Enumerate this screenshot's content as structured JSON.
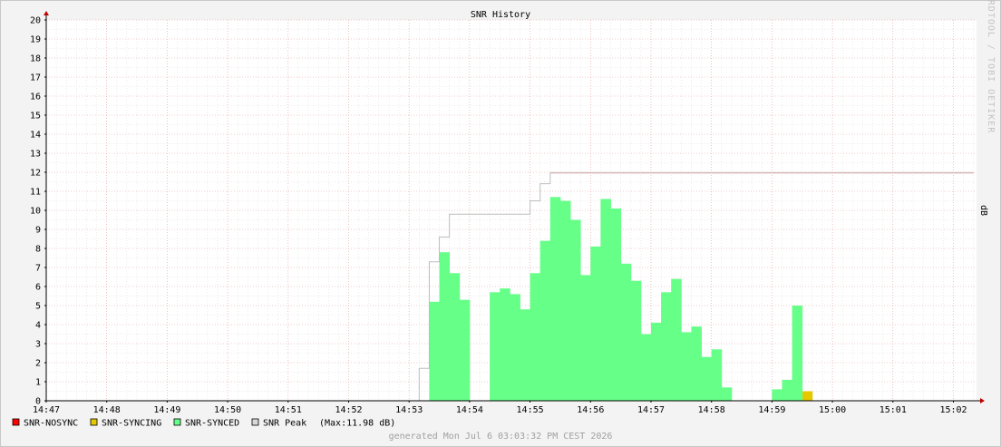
{
  "chart_data": {
    "type": "area",
    "title": "SNR History",
    "ylabel": "dB",
    "ylim": [
      0,
      20
    ],
    "yticks": [
      "0",
      "1",
      "2",
      "3",
      "4",
      "5",
      "6",
      "7",
      "8",
      "9",
      "10",
      "11",
      "12",
      "13",
      "14",
      "15",
      "16",
      "17",
      "18",
      "19",
      "20"
    ],
    "xlim": [
      "14:47:00",
      "14:59:30"
    ],
    "xticks": [
      "14:47",
      "14:48",
      "14:49",
      "14:50",
      "14:51",
      "14:52",
      "14:53",
      "14:54",
      "14:55",
      "14:56",
      "14:57",
      "14:58",
      "14:59",
      "15:00",
      "15:01",
      "15:02"
    ],
    "grid": true,
    "bucket_seconds": 10,
    "series": [
      {
        "name": "SNR-NOSYNC",
        "color": "#ff0000",
        "values": []
      },
      {
        "name": "SNR-SYNCING",
        "color": "#e6c800",
        "values": [
          {
            "t": "14:59:30",
            "v": 0.5
          }
        ]
      },
      {
        "name": "SNR-SYNCED",
        "color": "#66ff88",
        "values": [
          {
            "t": "14:53:20",
            "v": 5.2
          },
          {
            "t": "14:53:30",
            "v": 7.8
          },
          {
            "t": "14:53:40",
            "v": 6.7
          },
          {
            "t": "14:53:50",
            "v": 5.3
          },
          {
            "t": "14:54:20",
            "v": 5.7
          },
          {
            "t": "14:54:30",
            "v": 5.9
          },
          {
            "t": "14:54:40",
            "v": 5.6
          },
          {
            "t": "14:54:50",
            "v": 4.8
          },
          {
            "t": "14:55:00",
            "v": 6.7
          },
          {
            "t": "14:55:10",
            "v": 8.4
          },
          {
            "t": "14:55:20",
            "v": 10.7
          },
          {
            "t": "14:55:30",
            "v": 10.5
          },
          {
            "t": "14:55:40",
            "v": 9.5
          },
          {
            "t": "14:55:50",
            "v": 6.6
          },
          {
            "t": "14:56:00",
            "v": 8.1
          },
          {
            "t": "14:56:10",
            "v": 10.6
          },
          {
            "t": "14:56:20",
            "v": 10.1
          },
          {
            "t": "14:56:30",
            "v": 7.2
          },
          {
            "t": "14:56:40",
            "v": 6.3
          },
          {
            "t": "14:56:50",
            "v": 3.5
          },
          {
            "t": "14:57:00",
            "v": 4.1
          },
          {
            "t": "14:57:10",
            "v": 5.7
          },
          {
            "t": "14:57:20",
            "v": 6.4
          },
          {
            "t": "14:57:30",
            "v": 3.6
          },
          {
            "t": "14:57:40",
            "v": 3.9
          },
          {
            "t": "14:57:50",
            "v": 2.3
          },
          {
            "t": "14:58:00",
            "v": 2.7
          },
          {
            "t": "14:58:10",
            "v": 0.7
          },
          {
            "t": "14:59:00",
            "v": 0.6
          },
          {
            "t": "14:59:10",
            "v": 1.1
          },
          {
            "t": "14:59:20",
            "v": 5.0
          }
        ]
      },
      {
        "name": "SNR Peak",
        "color": "#c0c0c0",
        "values": [
          {
            "t": "14:53:10",
            "v": 1.7
          },
          {
            "t": "14:53:20",
            "v": 7.3
          },
          {
            "t": "14:53:30",
            "v": 8.6
          },
          {
            "t": "14:53:40",
            "v": 9.8
          },
          {
            "t": "14:54:50",
            "v": 9.8
          },
          {
            "t": "14:55:00",
            "v": 10.5
          },
          {
            "t": "14:55:10",
            "v": 11.4
          },
          {
            "t": "14:55:20",
            "v": 11.98
          },
          {
            "t": "15:02:20",
            "v": 11.98
          }
        ]
      }
    ],
    "legend_position": "bottom-left",
    "legend_note": "(Max:11.98 dB)",
    "footer": "generated Mon Jul  6 03:03:32 PM CEST 2026",
    "watermark": "RRDTOOL / TOBI OETIKER"
  }
}
